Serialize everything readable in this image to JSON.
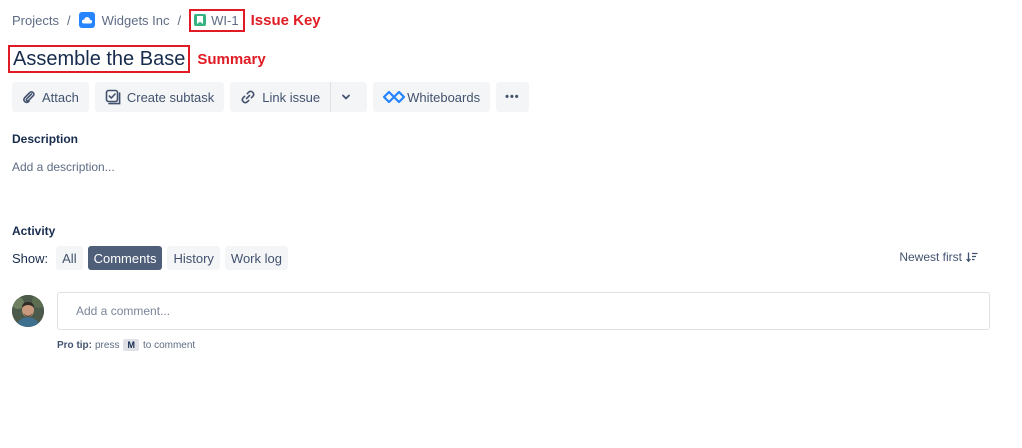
{
  "breadcrumb": {
    "projects_label": "Projects",
    "separator": "/",
    "project_name": "Widgets Inc",
    "issue_key": "WI-1",
    "issue_key_annotation": "Issue Key"
  },
  "summary": {
    "title": "Assemble the Base",
    "annotation": "Summary"
  },
  "toolbar": {
    "attach_label": "Attach",
    "create_subtask_label": "Create subtask",
    "link_issue_label": "Link issue",
    "whiteboards_label": "Whiteboards",
    "more_label": "•••"
  },
  "description": {
    "heading": "Description",
    "placeholder": "Add a description..."
  },
  "activity": {
    "heading": "Activity",
    "show_label": "Show:",
    "filters": [
      "All",
      "Comments",
      "History",
      "Work log"
    ],
    "active_filter": "Comments",
    "sort_label": "Newest first"
  },
  "comment": {
    "placeholder": "Add a comment...",
    "protip_prefix": "Pro tip:",
    "protip_press": "press",
    "protip_key": "M",
    "protip_suffix": "to comment"
  },
  "colors": {
    "annotation_red": "#e01b24",
    "accent_blue": "#2684ff",
    "story_green": "#36b37e",
    "active_chip": "#505f79"
  },
  "icons": {
    "project": "cloud-icon",
    "issue_type": "story-icon",
    "attach": "paperclip-icon",
    "subtask": "subtask-icon",
    "link": "link-icon",
    "whiteboards": "whiteboards-icon",
    "sort": "sort-icon"
  }
}
